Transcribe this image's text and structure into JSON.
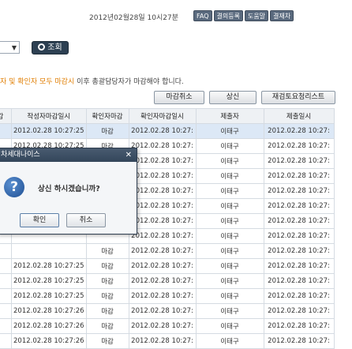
{
  "header": {
    "datetime": "2012년02월28일 10시27분",
    "buttons": [
      "FAQ",
      "결의등록",
      "도움말",
      "결재차"
    ]
  },
  "filter": {
    "search_label": "조회"
  },
  "notice": {
    "highlight": "자 및 확인자 모두 마감시",
    "normal": "이후 총괄담당자가 마감해야 합니다."
  },
  "actions": {
    "close_cancel": "마감취소",
    "submit": "상신",
    "review_list": "재검토요청리스트"
  },
  "table": {
    "headers": [
      "감",
      "작성자마감일시",
      "확인자마감",
      "확인자마감일시",
      "제출자",
      "제출일시"
    ],
    "rows": [
      [
        "",
        "2012.02.28 10:27:25",
        "마감",
        "2012.02.28 10:27:",
        "이태구",
        "2012.02.28 10:27:"
      ],
      [
        "",
        "2012.02.28 10:27:25",
        "마감",
        "2012.02.28 10:27:",
        "이태구",
        "2012.02.28 10:27:"
      ],
      [
        "",
        "",
        "",
        "2012.02.28 10:27:",
        "이태구",
        "2012.02.28 10:27:"
      ],
      [
        "",
        "",
        "",
        "2012.02.28 10:27:",
        "이태구",
        "2012.02.28 10:27:"
      ],
      [
        "",
        "",
        "",
        "2012.02.28 10:27:",
        "이태구",
        "2012.02.28 10:27:"
      ],
      [
        "",
        "",
        "",
        "2012.02.28 10:27:",
        "이태구",
        "2012.02.28 10:27:"
      ],
      [
        "",
        "",
        "",
        "2012.02.28 10:27:",
        "이태구",
        "2012.02.28 10:27:"
      ],
      [
        "",
        "",
        "",
        "2012.02.28 10:27:",
        "이태구",
        "2012.02.28 10:27:"
      ],
      [
        "",
        "",
        "마감",
        "2012.02.28 10:27:",
        "이태구",
        "2012.02.28 10:27:"
      ],
      [
        "",
        "2012.02.28 10:27:25",
        "마감",
        "2012.02.28 10:27:",
        "이태구",
        "2012.02.28 10:27:"
      ],
      [
        "",
        "2012.02.28 10:27:25",
        "마감",
        "2012.02.28 10:27:",
        "이태구",
        "2012.02.28 10:27:"
      ],
      [
        "",
        "2012.02.28 10:27:25",
        "마감",
        "2012.02.28 10:27:",
        "이태구",
        "2012.02.28 10:27:"
      ],
      [
        "",
        "2012.02.28 10:27:26",
        "마감",
        "2012.02.28 10:27:",
        "이태구",
        "2012.02.28 10:27:"
      ],
      [
        "",
        "2012.02.28 10:27:26",
        "마감",
        "2012.02.28 10:27:",
        "이태구",
        "2012.02.28 10:27:"
      ],
      [
        "",
        "2012.02.28 10:27:26",
        "마감",
        "2012.02.28 10:27:",
        "이태구",
        "2012.02.28 10:27:"
      ]
    ]
  },
  "dialog": {
    "title": "차세대나이스",
    "message": "상신 하시겠습니까?",
    "ok": "확인",
    "cancel": "취소"
  }
}
